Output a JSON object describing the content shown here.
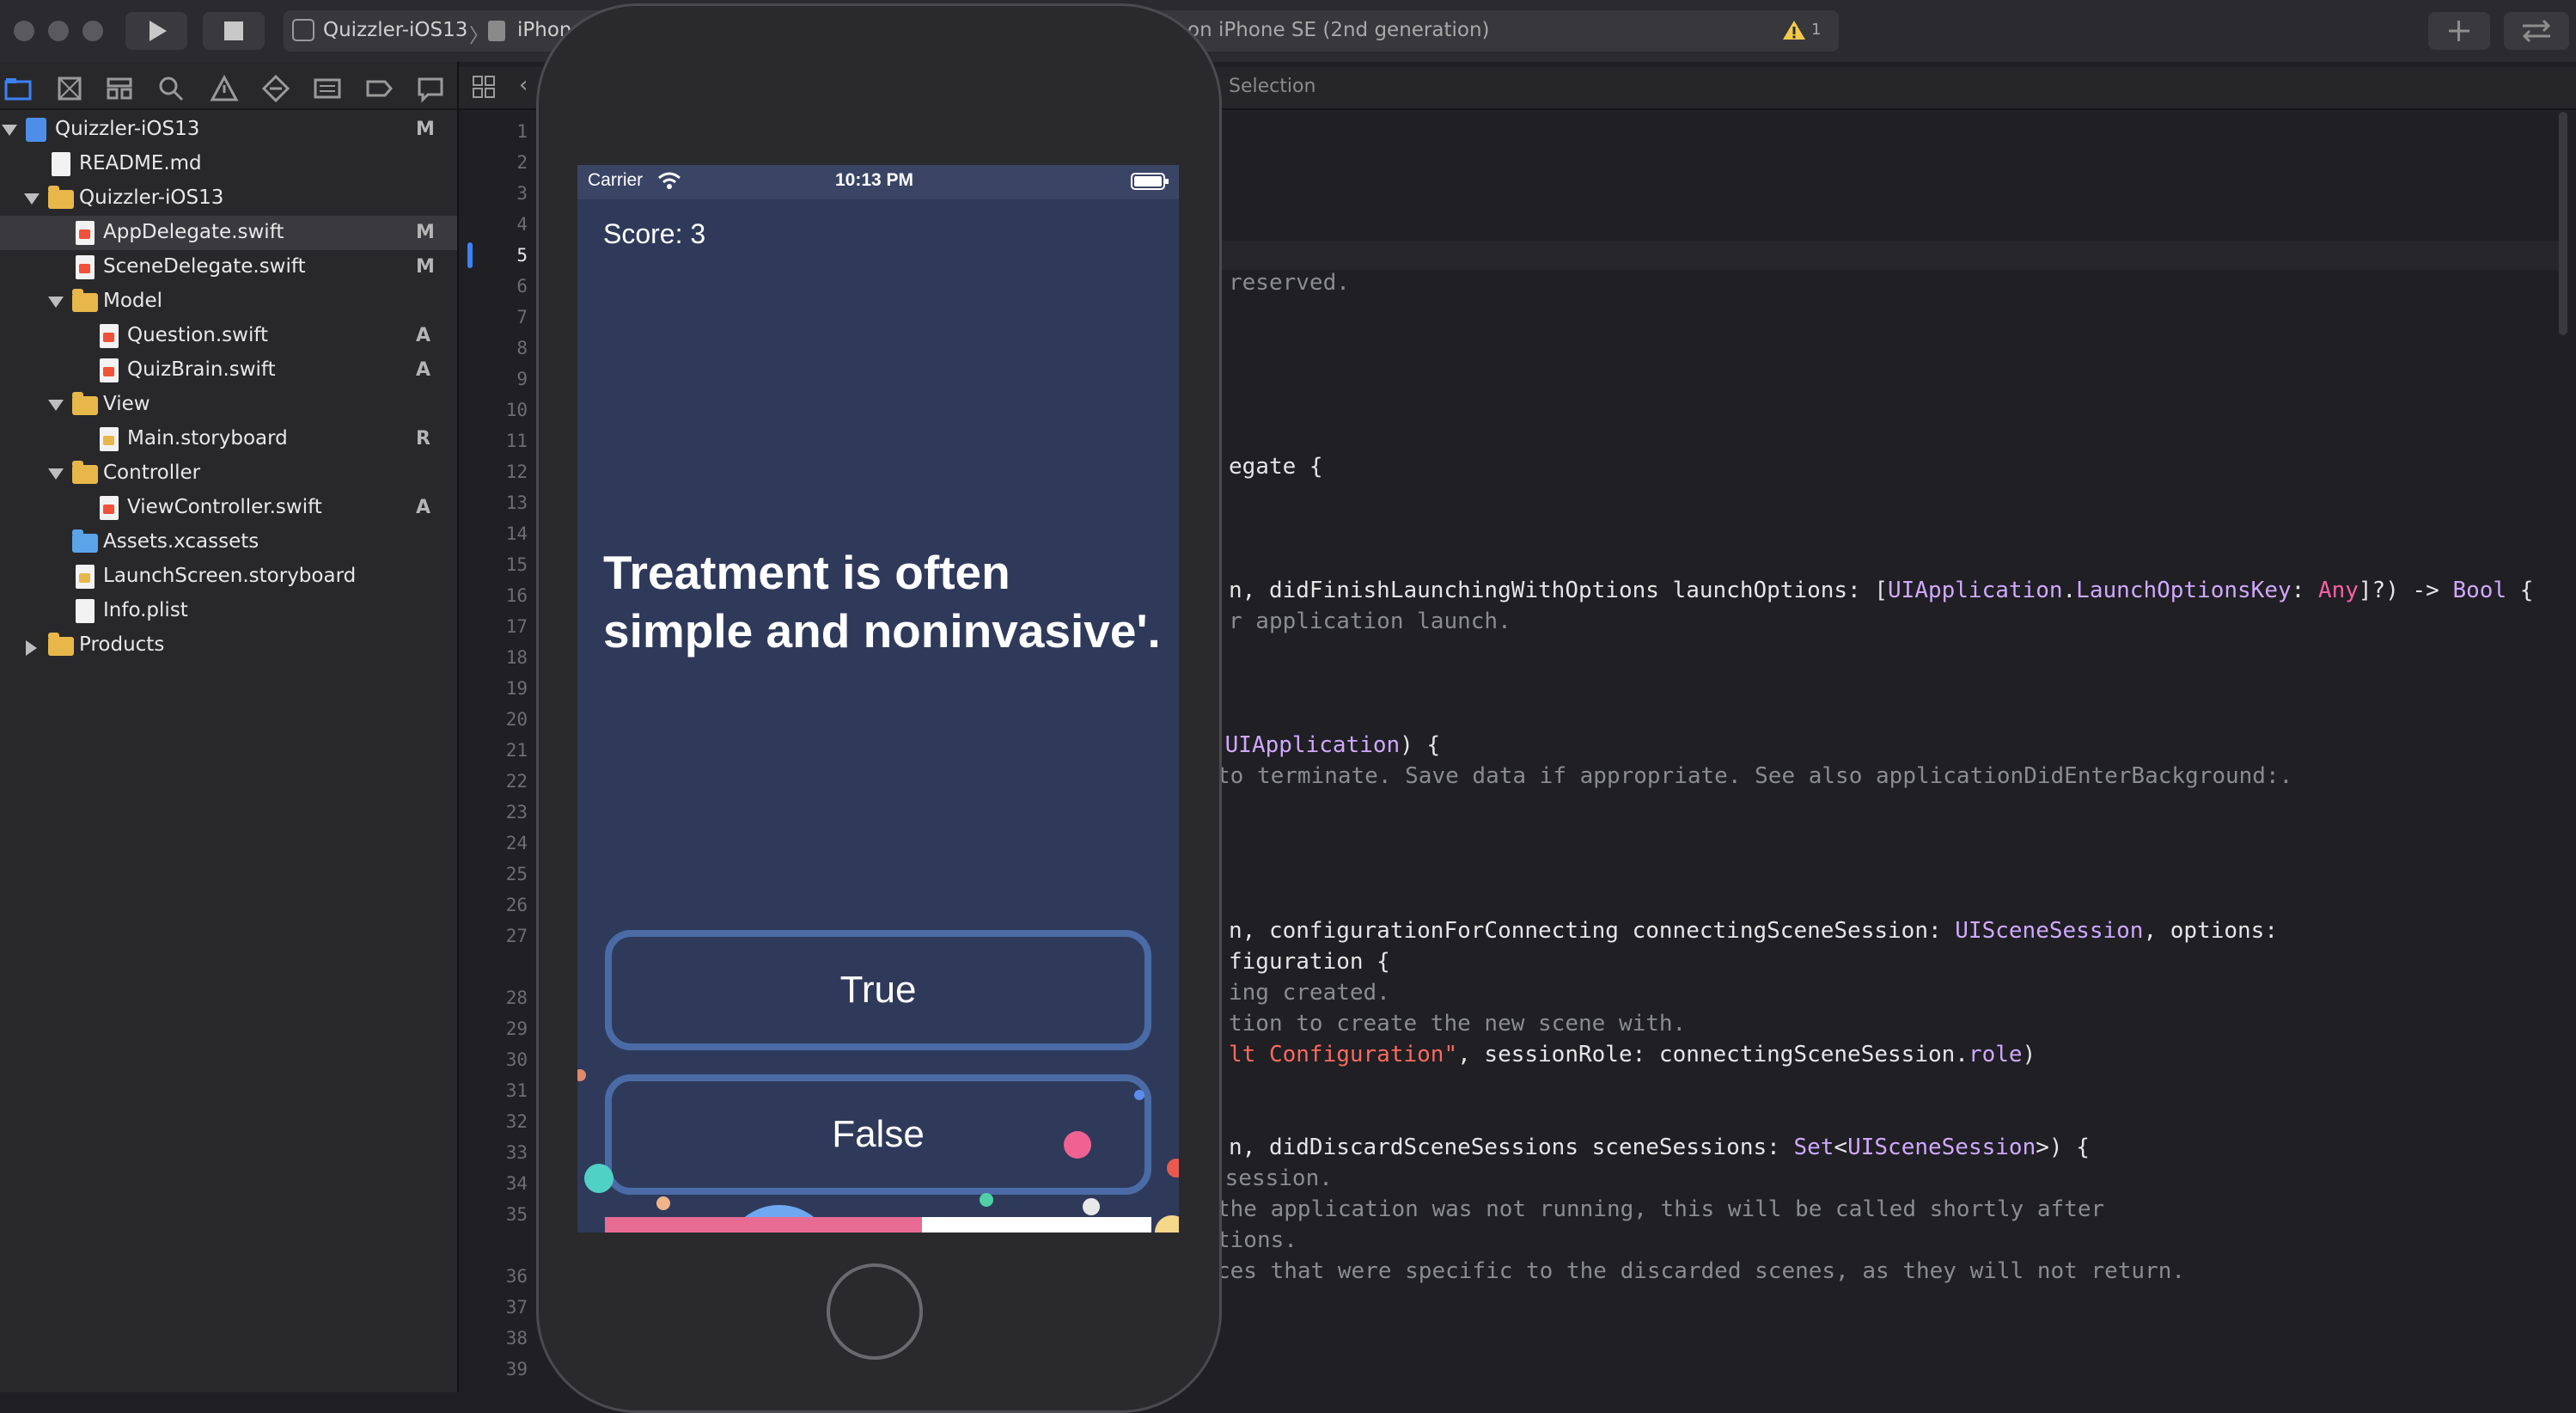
{
  "toolbar": {
    "scheme": "Quizzler-iOS13",
    "device_short": "iPhon",
    "status": "on iPhone SE (2nd generation)",
    "warning_count": "1"
  },
  "jumpbar": {
    "crumb": "Selection"
  },
  "navigator": {
    "items": [
      {
        "label": "Quizzler-iOS13",
        "badge": "M"
      },
      {
        "label": "README.md",
        "badge": ""
      },
      {
        "label": "Quizzler-iOS13",
        "badge": ""
      },
      {
        "label": "AppDelegate.swift",
        "badge": "M"
      },
      {
        "label": "SceneDelegate.swift",
        "badge": "M"
      },
      {
        "label": "Model",
        "badge": ""
      },
      {
        "label": "Question.swift",
        "badge": "A"
      },
      {
        "label": "QuizBrain.swift",
        "badge": "A"
      },
      {
        "label": "View",
        "badge": ""
      },
      {
        "label": "Main.storyboard",
        "badge": "R"
      },
      {
        "label": "Controller",
        "badge": ""
      },
      {
        "label": "ViewController.swift",
        "badge": "A"
      },
      {
        "label": "Assets.xcassets",
        "badge": ""
      },
      {
        "label": "LaunchScreen.storyboard",
        "badge": ""
      },
      {
        "label": "Info.plist",
        "badge": ""
      },
      {
        "label": "Products",
        "badge": ""
      }
    ]
  },
  "editor": {
    "line_numbers": [
      "1",
      "2",
      "3",
      "4",
      "5",
      "6",
      "7",
      "8",
      "9",
      "10",
      "11",
      "12",
      "13",
      "14",
      "15",
      "16",
      "17",
      "18",
      "19",
      "20",
      "21",
      "22",
      "23",
      "24",
      "25",
      "26",
      "27",
      "28",
      "29",
      "30",
      "31",
      "32",
      "33",
      "34",
      "35",
      "36",
      "37",
      "38",
      "39"
    ],
    "current_line": "5",
    "code": {
      "l6": "reserved.",
      "l12": "egate {",
      "l16a": "n, didFinishLaunchingWithOptions launchOptions: [",
      "l16b": "UIApplication",
      "l16c": ".",
      "l16d": "LaunchOptionsKey",
      "l16e": ": ",
      "l16f": "Any",
      "l16g": "]?) -> ",
      "l16h": "Bool",
      "l16i": " {",
      "l17": "r application launch.",
      "l21a": " ",
      "l21b": "UIApplication",
      "l21c": ") {",
      "l22": "to terminate. Save data if appropriate. See also applicationDidEnterBackground:.",
      "l27a": "n, configurationForConnecting connectingSceneSession: ",
      "l27b": "UISceneSession",
      "l27c": ", options:",
      "l27w": "figuration {",
      "l28": "ing created.",
      "l29": "tion to create the new scene with.",
      "l30a": "lt Configuration\"",
      "l30b": ", sessionRole: connectingSceneSession.",
      "l30c": "role",
      "l30d": ")",
      "l33a": "n, didDiscardSceneSessions sceneSessions: ",
      "l33b": "Set",
      "l33c": "<",
      "l33d": "UISceneSession",
      "l33e": ">) {",
      "l34": " session.",
      "l35": "the application was not running, this will be called shortly after",
      "l35w": "tions.",
      "l36": "ces that were specific to the discarded scenes, as they will not return."
    }
  },
  "simulator": {
    "carrier": "Carrier",
    "time": "10:13 PM",
    "score": "Score: 3",
    "question": "Treatment is often simple and noninvasive'.",
    "true_label": "True",
    "false_label": "False",
    "progress_fraction": 0.58,
    "colors": {
      "background": "#2f3a5b",
      "button_border": "#4a6ba5",
      "progress_fill": "#e86b93",
      "progress_track": "#ffffff"
    }
  },
  "icons": [
    "play-icon",
    "stop-icon",
    "warning-icon",
    "plus-icon",
    "swap-icon",
    "folder-icon",
    "search-icon",
    "wifi-icon",
    "battery-icon"
  ]
}
